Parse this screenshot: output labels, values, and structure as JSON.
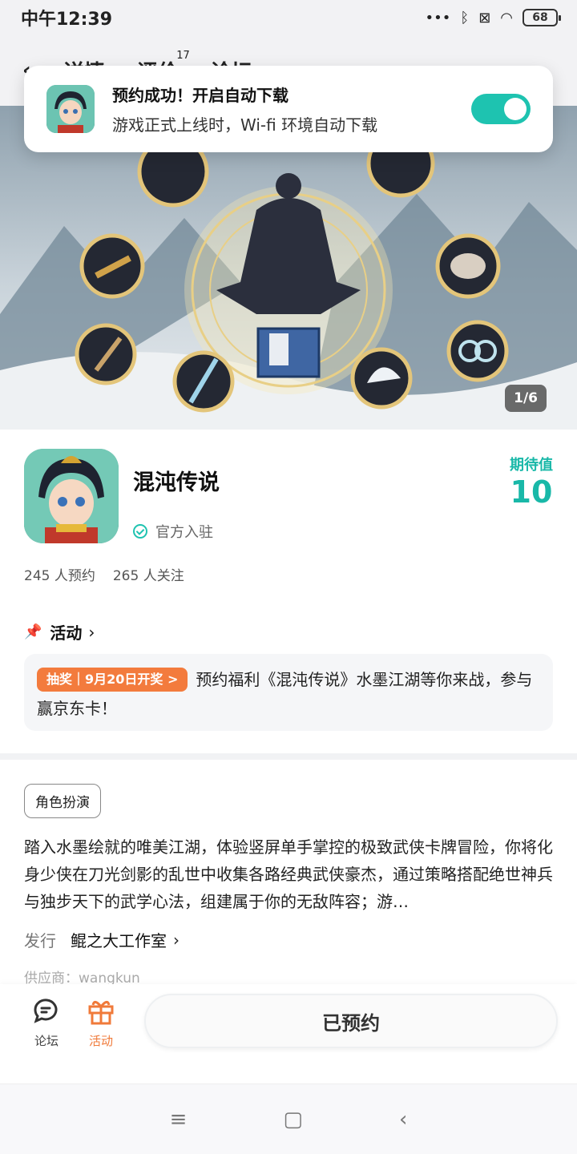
{
  "status_bar": {
    "time": "中午12:39",
    "battery": "68"
  },
  "nav": {
    "back_icon": "back-arrow-icon",
    "tabs": [
      "详情",
      "评价",
      "论坛"
    ],
    "review_count": "17"
  },
  "toast": {
    "title": "预约成功！开启自动下载",
    "subtitle": "游戏正式上线时，Wi-fi 环境自动下载",
    "toggle_on": true
  },
  "banner": {
    "page_indicator": "1/6"
  },
  "game": {
    "name": "混沌传说",
    "verified_label": "官方入驻",
    "expect_label": "期待值",
    "expect_value": "10",
    "reservations": "245 人预约",
    "follows": "265 人关注"
  },
  "activity": {
    "header": "活动",
    "tag": "抽奖｜9月20日开奖 >",
    "text": "预约福利《混沌传说》水墨江湖等你来战，参与赢京东卡！"
  },
  "description": {
    "genre": "角色扮演",
    "text": "踏入水墨绘就的唯美江湖，体验竖屏单手掌控的极致武侠卡牌冒险，你将化身少侠在刀光剑影的乱世中收集各路经典武侠豪杰，通过策略搭配绝世神兵与独步天下的武学心法，组建属于你的无敌阵容；游…",
    "publisher_label": "发行",
    "publisher_name": "鲲之大工作室",
    "supplier": "供应商：wangkun"
  },
  "action_bar": {
    "forum_label": "论坛",
    "activity_label": "活动",
    "reserved_label": "已预约"
  },
  "colors": {
    "accent": "#1ec3b0",
    "orange": "#f37b3d"
  }
}
